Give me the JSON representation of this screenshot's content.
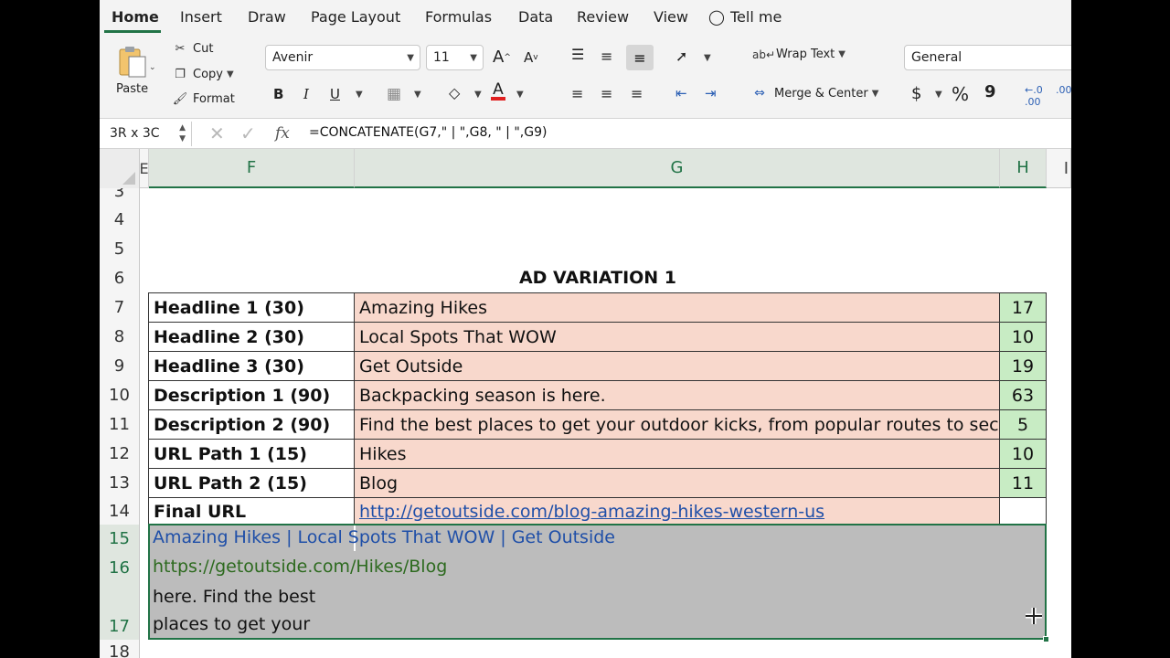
{
  "ribbon_tabs": [
    "Home",
    "Insert",
    "Draw",
    "Page Layout",
    "Formulas",
    "Data",
    "Review",
    "View",
    "Tell me"
  ],
  "clipboard": {
    "paste": "Paste",
    "cut": "Cut",
    "copy": "Copy",
    "format": "Format"
  },
  "font": {
    "name": "Avenir",
    "size": "11"
  },
  "alignment": {
    "wrap_text": "Wrap Text",
    "merge_center": "Merge & Center"
  },
  "number": {
    "format": "General",
    "currency": "$",
    "percent": "%",
    "comma": "9"
  },
  "formula_bar": {
    "name_box": "3R x 3C",
    "fx": "fx",
    "formula": "=CONCATENATE(G7,\" | \",G8, \" | \",G9)"
  },
  "columns": [
    "E",
    "F",
    "G",
    "H",
    "I"
  ],
  "rows": [
    "3",
    "4",
    "5",
    "6",
    "7",
    "8",
    "9",
    "10",
    "11",
    "12",
    "13",
    "14",
    "15",
    "16",
    "17",
    "18"
  ],
  "sheet": {
    "title": "AD VARIATION 1",
    "table": [
      {
        "label": "Headline 1 (30)",
        "value": "Amazing Hikes",
        "count": "17"
      },
      {
        "label": "Headline 2 (30)",
        "value": "Local Spots That WOW",
        "count": "10"
      },
      {
        "label": "Headline 3 (30)",
        "value": "Get Outside",
        "count": "19"
      },
      {
        "label": "Description 1 (90)",
        "value": "Backpacking season is here.",
        "count": "63"
      },
      {
        "label": "Description 2 (90)",
        "value": "Find the best places to get your outdoor kicks, from popular routes to seclu",
        "count": "5"
      },
      {
        "label": "URL Path 1 (15)",
        "value": "Hikes",
        "count": "10"
      },
      {
        "label": "URL Path 2 (15)",
        "value": "Blog",
        "count": "11"
      },
      {
        "label": "Final URL",
        "value": "http://getoutside.com/blog-amazing-hikes-western-us",
        "count": ""
      }
    ],
    "preview": {
      "headline": "Amazing Hikes | Local Spots That WOW | Get Outside",
      "url": "https://getoutside.com/Hikes/Blog",
      "desc_line1": "here. Find the best",
      "desc_line2": "places to get your"
    }
  },
  "colors": {
    "accent": "#217346",
    "value_fill": "#f8d8cc",
    "count_fill": "#c8ecc4",
    "selection": "#bcbcbc",
    "headline_blue": "#1f4fa8",
    "url_green": "#2d6a1f"
  }
}
